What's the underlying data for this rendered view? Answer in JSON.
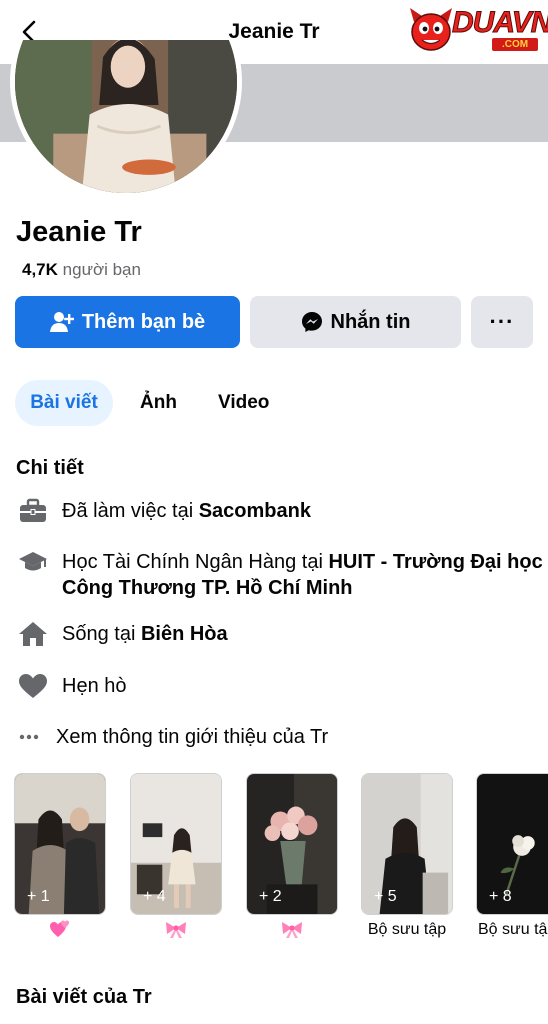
{
  "header": {
    "title": "Jeanie Tr",
    "back_icon": "chevron-left-icon"
  },
  "logo": {
    "word": "DUAVN",
    "sub": ".COM"
  },
  "profile": {
    "name": "Jeanie Tr",
    "friends_count": "4,7K",
    "friends_label": "người bạn"
  },
  "actions": {
    "add_friend": "Thêm bạn bè",
    "message": "Nhắn tin",
    "more": "···"
  },
  "tabs": {
    "posts": "Bài viết",
    "photos": "Ảnh",
    "video": "Video"
  },
  "details": {
    "title": "Chi tiết",
    "work_prefix": "Đã làm việc tại ",
    "work_place": "Sacombank",
    "study_prefix": "Học Tài Chính Ngân Hàng tại ",
    "study_place": "HUIT - Trường Đại học Công Thương TP. Hồ Chí Minh",
    "live_prefix": "Sống tại ",
    "live_place": "Biên Hòa",
    "relationship": "Hẹn hò",
    "see_about": "Xem thông tin giới thiệu của Tr"
  },
  "highlights": [
    {
      "count": "+ 1",
      "label": "",
      "emoji": "pink-hearts-icon"
    },
    {
      "count": "+ 4",
      "label": "",
      "emoji": "pink-bow-icon"
    },
    {
      "count": "+ 2",
      "label": "",
      "emoji": "pink-bow-icon"
    },
    {
      "count": "+ 5",
      "label": "Bộ sưu tập",
      "emoji": ""
    },
    {
      "count": "+ 8",
      "label": "Bộ sưu tập",
      "emoji": ""
    }
  ],
  "posts_section": {
    "title": "Bài viết của Tr"
  },
  "colors": {
    "primary": "#1b74e4",
    "secondary_bg": "#e4e6eb",
    "tab_active_bg": "#e7f3ff",
    "cover": "#c9cbce"
  }
}
